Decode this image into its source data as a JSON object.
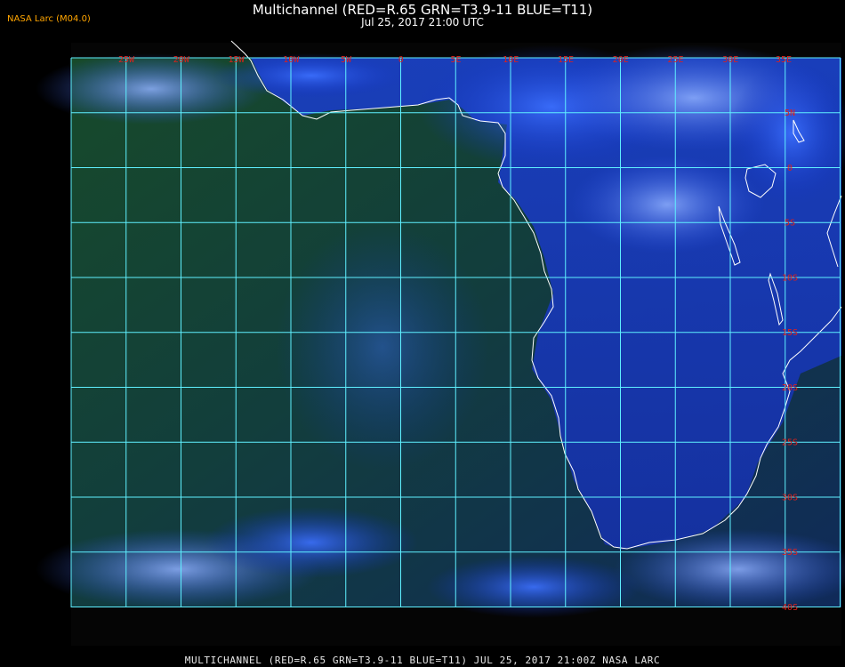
{
  "header": {
    "title": "Multichannel (RED=R.65 GRN=T3.9-11 BLUE=T11)",
    "subtitle": "Jul 25, 2017 21:00 UTC",
    "brand": "NASA Larc (M04.0)"
  },
  "footer": {
    "text": "MULTICHANNEL (RED=R.65 GRN=T3.9-11 BLUE=T11) JUL 25, 2017 21:00Z   NASA LARC"
  },
  "map": {
    "lon_labels": [
      "25W",
      "20W",
      "15W",
      "10W",
      "5W",
      "0",
      "5E",
      "10E",
      "15E",
      "20E",
      "25E",
      "30E",
      "35E"
    ],
    "lat_labels": [
      "5N",
      "0",
      "5S",
      "10S",
      "15S",
      "20S",
      "25S",
      "30S",
      "35S",
      "40S"
    ],
    "colors": {
      "grid": "#5ff0ff",
      "label": "#e0201a",
      "coast": "#ffffff"
    }
  }
}
